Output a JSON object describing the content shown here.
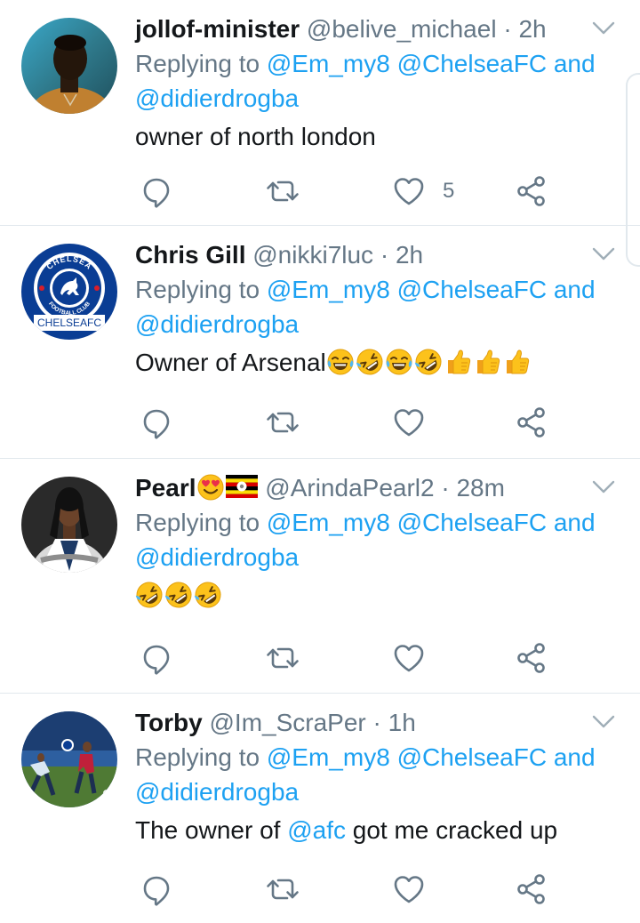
{
  "reply_prefix": "Replying to",
  "colors": {
    "link": "#1da1f2",
    "muted": "#657786",
    "text": "#14171a",
    "divider": "#e1e8ed"
  },
  "tweets": [
    {
      "name": "jollof-minister",
      "handle": "@belive_michael",
      "separator": "·",
      "time": "2h",
      "reply_to": [
        "@Em_my8",
        "@ChelseaFC",
        "and",
        "@didierdrogba"
      ],
      "text": "owner of north london",
      "like_count": "5",
      "avatar": "man-shirtless-avatar"
    },
    {
      "name": "Chris Gill",
      "handle": "@nikki7luc",
      "separator": "·",
      "time": "2h",
      "reply_to": [
        "@Em_my8",
        "@ChelseaFC",
        "and",
        "@didierdrogba"
      ],
      "text": "Owner of Arsenal",
      "emojis": [
        "face-with-tears-of-joy",
        "rolling-on-the-floor-laughing",
        "face-with-tears-of-joy",
        "rolling-on-the-floor-laughing",
        "thumbs-up",
        "thumbs-up",
        "thumbs-up"
      ],
      "like_count": "",
      "avatar": "chelsea-fc-crest-avatar",
      "avatar_text": {
        "top": "CHELSEA",
        "bottom": "FOOTBALL CLUB",
        "banner": "CHELSEAFC"
      }
    },
    {
      "name": "Pearl",
      "name_emojis": [
        "smiling-face-with-heart-eyes",
        "uganda-flag"
      ],
      "handle": "@ArindaPearl2",
      "separator": "·",
      "time": "28m",
      "reply_to": [
        "@Em_my8",
        "@ChelseaFC",
        "and",
        "@didierdrogba"
      ],
      "text": "",
      "emojis": [
        "rolling-on-the-floor-laughing",
        "rolling-on-the-floor-laughing",
        "rolling-on-the-floor-laughing"
      ],
      "like_count": "",
      "avatar": "woman-portrait-avatar"
    },
    {
      "name": "Torby",
      "handle": "@Im_ScraPer",
      "separator": "·",
      "time": "1h",
      "reply_to": [
        "@Em_my8",
        "@ChelseaFC",
        "and",
        "@didierdrogba"
      ],
      "text_before": "The owner of ",
      "text_mention": "@afc",
      "text_after": " got me cracked up",
      "like_count": "",
      "avatar": "football-training-avatar"
    }
  ]
}
